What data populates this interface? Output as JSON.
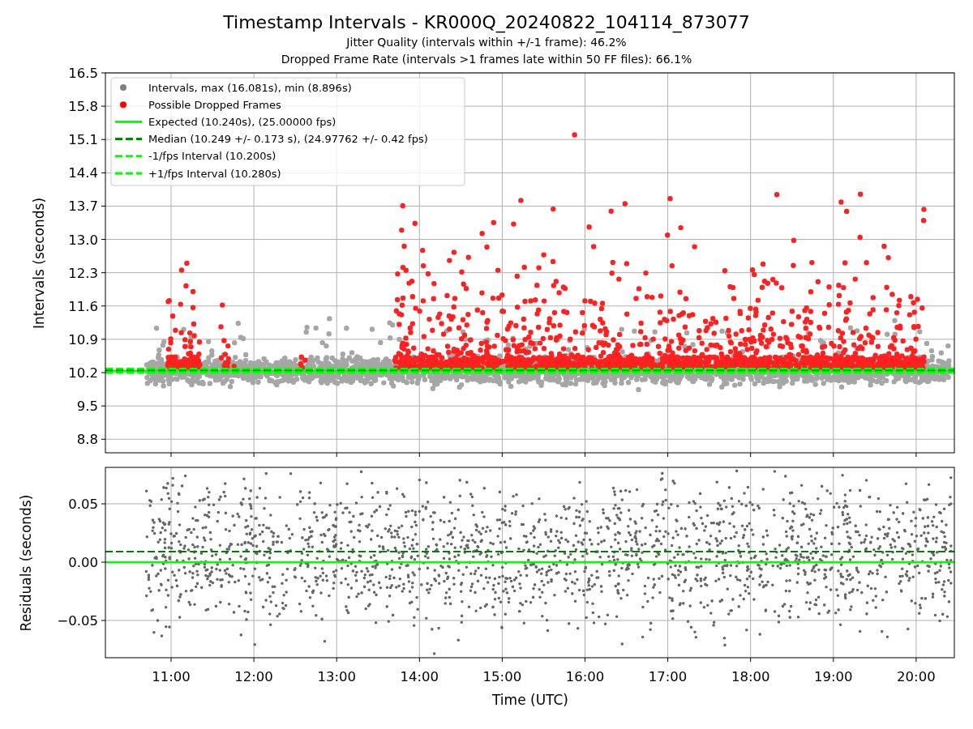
{
  "figure": {
    "title": "Timestamp Intervals - KR000Q_20240822_104114_873077",
    "subtitles": [
      "Jitter Quality (intervals within +/-1 frame): 46.2%",
      "Dropped Frame Rate (intervals >1 frames late within 50 FF files): 66.1%"
    ]
  },
  "main_panel": {
    "ylabel": "Intervals (seconds)",
    "yticks": [
      "16.5",
      "15.8",
      "15.1",
      "14.4",
      "13.7",
      "13.0",
      "12.3",
      "11.6",
      "10.9",
      "10.2",
      "9.5",
      "8.8"
    ],
    "legend": [
      {
        "label": "Intervals, max (16.081s), min (8.896s)",
        "kind": "marker",
        "color": "#808080"
      },
      {
        "label": "Possible Dropped Frames",
        "kind": "marker",
        "color": "#ff0000"
      },
      {
        "label": "Expected (10.240s), (25.00000 fps)",
        "kind": "solid",
        "color": "#00ff00"
      },
      {
        "label": "Median (10.249 +/- 0.173 s), (24.97762 +/- 0.42 fps)",
        "kind": "dashed",
        "color": "#008000"
      },
      {
        "label": "-1/fps Interval (10.200s)",
        "kind": "dashed",
        "color": "#00ff00"
      },
      {
        "label": "+1/fps Interval (10.280s)",
        "kind": "dashed",
        "color": "#00ff00"
      }
    ]
  },
  "residual_panel": {
    "ylabel": "Residuals (seconds)",
    "yticks": [
      "0.05",
      "0.00",
      "−0.05"
    ]
  },
  "xaxis": {
    "label": "Time (UTC)",
    "ticks": [
      "11:00",
      "12:00",
      "13:00",
      "14:00",
      "15:00",
      "16:00",
      "17:00",
      "18:00",
      "19:00",
      "20:00"
    ]
  }
}
